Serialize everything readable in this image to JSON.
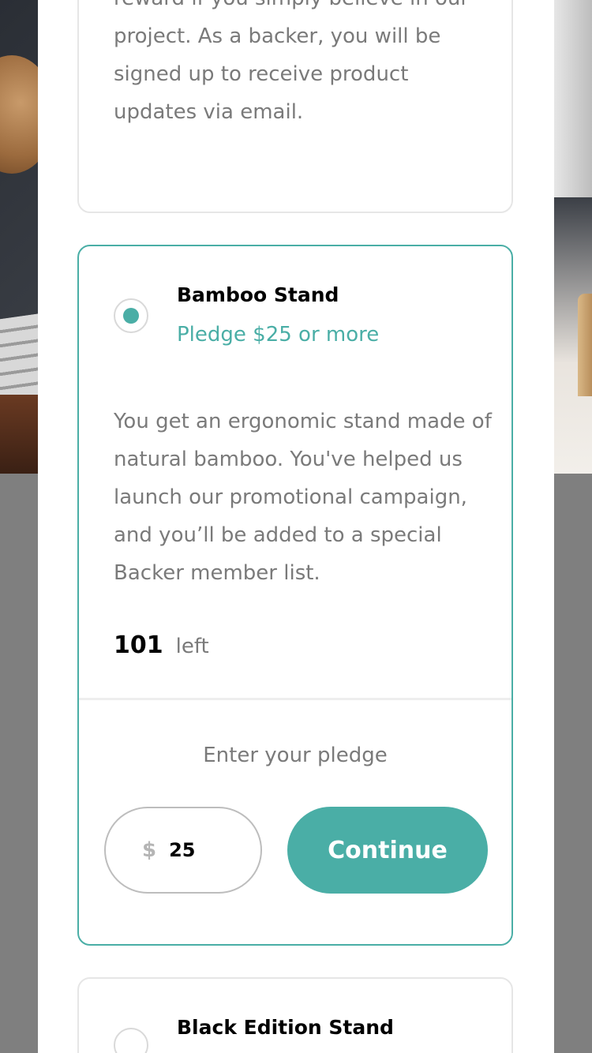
{
  "colors": {
    "accent": "#4aaea6",
    "body_text": "#7a7a7a",
    "overlay": "#7f7f7f"
  },
  "top_card": {
    "description": "reward if you simply believe in our project. As a backer, you will be signed up to receive product updates via email."
  },
  "selected_reward": {
    "title": "Bamboo Stand",
    "pledge_min": "Pledge $25 or more",
    "description": "You get an ergonomic stand made of natural bamboo. You've helped us launch our promotional campaign, and you’ll be added to a special Backer member list.",
    "stock_count": "101",
    "stock_label": "left",
    "enter_pledge_label": "Enter your pledge",
    "currency_symbol": "$",
    "amount_value": "25",
    "continue_label": "Continue",
    "selected": true
  },
  "next_reward": {
    "title": "Black Edition Stand",
    "selected": false
  }
}
